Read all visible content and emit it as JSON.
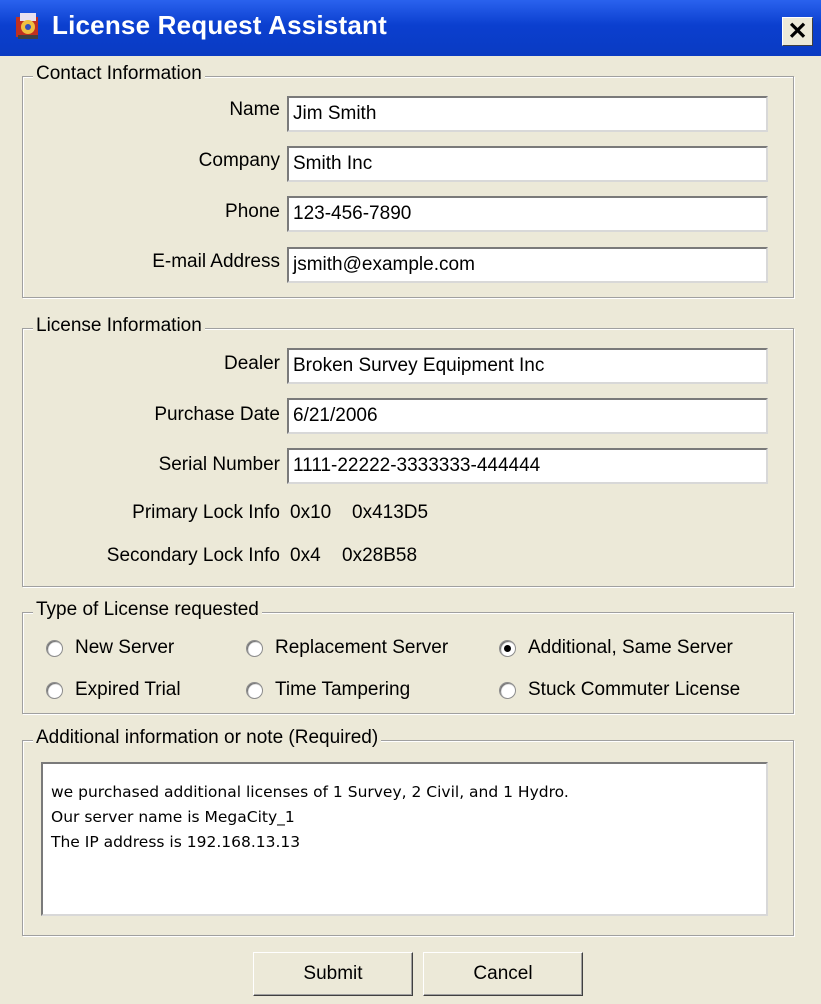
{
  "window": {
    "title": "License Request Assistant",
    "close_label": "✕"
  },
  "contact": {
    "legend": "Contact Information",
    "name_label": "Name",
    "name_value": "Jim Smith",
    "company_label": "Company",
    "company_value": "Smith Inc",
    "phone_label": "Phone",
    "phone_value": "123-456-7890",
    "email_label": "E-mail Address",
    "email_value": "jsmith@example.com"
  },
  "license": {
    "legend": "License Information",
    "dealer_label": "Dealer",
    "dealer_value": "Broken Survey Equipment Inc",
    "purchase_label": "Purchase Date",
    "purchase_value": "6/21/2006",
    "serial_label": "Serial Number",
    "serial_value": "1111-22222-3333333-444444",
    "primary_label": "Primary Lock Info",
    "primary_a": "0x10",
    "primary_b": "0x413D5",
    "secondary_label": "Secondary Lock Info",
    "secondary_a": "0x4",
    "secondary_b": "0x28B58"
  },
  "type": {
    "legend": "Type of License requested",
    "options": [
      {
        "label": "New Server",
        "selected": false
      },
      {
        "label": "Replacement Server",
        "selected": false
      },
      {
        "label": "Additional, Same Server",
        "selected": true
      },
      {
        "label": "Expired Trial",
        "selected": false
      },
      {
        "label": "Time Tampering",
        "selected": false
      },
      {
        "label": "Stuck Commuter License",
        "selected": false
      }
    ]
  },
  "notes": {
    "legend": "Additional information or note (Required)",
    "lines": [
      "we purchased additional licenses of 1 Survey, 2 Civil, and 1 Hydro.",
      "Our server name is MegaCity_1",
      "The IP address is 192.168.13.13"
    ]
  },
  "buttons": {
    "submit": "Submit",
    "cancel": "Cancel"
  },
  "colors": {
    "titlebar": "#0a3bc2",
    "dialog_bg": "#ece9d8"
  },
  "icons": {
    "app": "app-icon",
    "close": "close-icon",
    "radio": "radio-icon"
  }
}
